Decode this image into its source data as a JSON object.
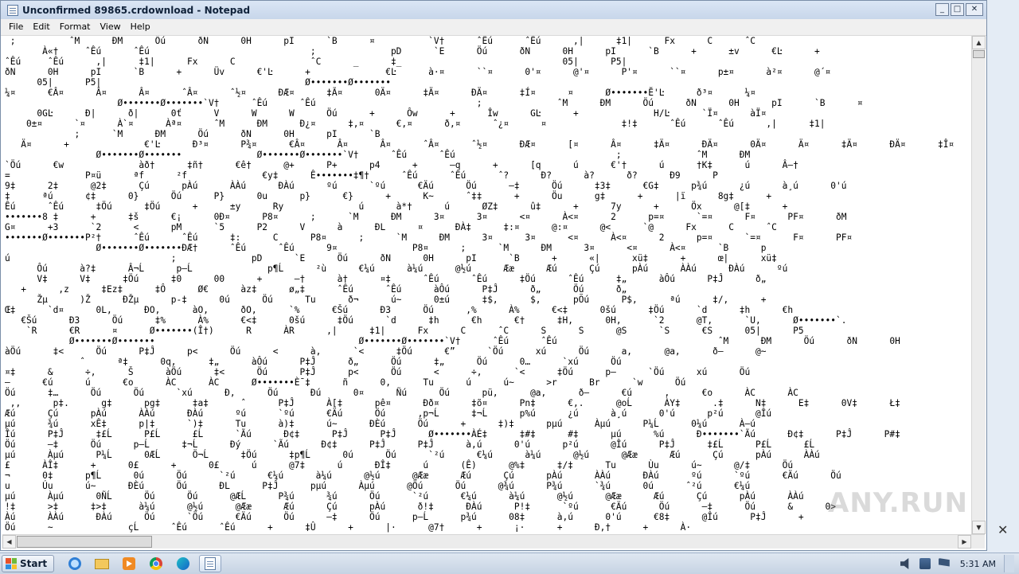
{
  "window": {
    "title": "Unconfirmed 89865.crdownload - Notepad",
    "buttons": {
      "minimize": "_",
      "maximize": "□",
      "close": "✕"
    }
  },
  "menu": [
    "File",
    "Edit",
    "Format",
    "View",
    "Help"
  ],
  "editor": {
    "lines": [
      " ;          ˆM      ÐM      Ôú      ðN      0H      pI      `B      ¤          `V†      ˆÊú      ˆÊú      ,|      ‡1|      Fx      C      ˆC",
      "       À«†     ˆÊú      ˆÊú                              ;              pD      `E      Öú      ðN      0H      pI      `B      +      ±v      €Ŀ      +",
      "ˆÊú     ˆÊú      ,|      ‡1|      Fx      C              ˆC      _      ‡_                              05|      P5|",
      "ðN      0H      pI      `B      +      Üv      €'Ŀ      +              €Ŀ      à·¤      ``¤      0'¤      @'¤      P'¤      ``¤      p±¤      à²¤      @´¤",
      "      05|      P5|                                      Ø•••••••Ø•••••••",
      "¼¤      €Â¤      Â¤      Â¤      ˆÂ¤      ˆ½¤      ÐÆ¤      ‡Ã¤      0Ä¤      ‡Ä¤      ÐÄ¤      ‡Í¤      ¤      Ø•••••••Ĕ'Ŀ      ð³¤      ¼¤",
      "                     Ø•••••••Ø•••••••`V†      ˆÊú      ˆÊú                              ;              ˆM      ÐM      Öú      ðN      0H      pI      `B      ¤",
      "      0GĿ      Ð|      ð|      0ť      V      W      W      Öú      +      Ôw      +      Îw      GĿ      +              H/Ŀ      `Ï¤      àÏ¤",
      "    0±¤      `¤      À`¤      Àª¤      ˆM      ÐM      Ð¿¤      ‡,¤      €,¤      ð,¤      ˆ¿¤      ¤              ‡!‡      ˆÊú      ˆÊú      ,|      ‡1|",
      "             ;      `M      ÐM      Öú      ðN      0H      pI      `B",
      "   Ä¤      +              €'Ŀ      Ð³¤      P¾¤      €Â¤      Â¤      Â¤      ˆÂ¤      ˆ½¤      ÐÆ¤      [¤      Â¤      ‡Ä¤      ÐÄ¤      0Ä¤      Ä¤      ‡Ä¤      ÐÄ¤      ‡Î¤",
      "                 Ø•••••••Ø•••••••              Ø•••••••Ø•••••••`V†      ˆÊú      ˆÊú                              ;              ˆM      ÐM",
      "`Öú      €w              àð†      ‡ñ†      €ê†      @+      P+      p4      +      –q      +      [q      ú      €'†      ú      †K‡      ú      Â–†",
      "=              P¤ü      ªf      ²f              €y‡      Ê•••••••‡¶†      ˆÊú      ˆÊú      ˆ?      Ð?      à?      ð?      Ð9      P",
      "9‡      2‡      @2‡      Çú      pÀú      ÀÀú      ÐÀú      ºú      `ºú      €Äú      Öú      –‡      Öú      ‡3‡      €G‡      p¾ú      ¿ú      à¸ú      0'ú",
      "‡      ªú      ¢‡      0}      Öú      P}      0u      p}      €}      +      K~      ˆ‡‡      +      Öu      g‡      +      |ï      8g‡      +",
      "Êú      ˆÊú      ‡Öú      ‡Öú      +      ±y      Ry              ú      à*†      ú      ØZ‡      û‡      +      7y      +      Öx      @[‡      +",
      "•••••••8 ‡      +      ‡š      €¡      0Ð¤      P8¤      ;      `M      ÐM      3¤      3¤      <¤      À<¤      2      p=¤      `=¤      F¤      PF¤      ðM",
      "G¤      +3      `2      <      pM      `5      P2      V      à      ÐL      ¤      ÐÀ‡      ‡:¤      @:¤      @<      `@      Fx      C      ˆC",
      "•••••••Ø•••••••P²†      ˆÊú      ˆÊú      ‡:      C      P8¤      ;      `M      ÐM      3¤      3¤      <¤      À<¤      2      p=¤      `=¤      F¤      PF¤",
      "                 Ø•••••••Ø•••••••ÐÆ†      ˆÊú      ˆÊú      9¤              P8¤      ;      `M      ÐM      3¤      <¤      À<¤      `B      p",
      "ú                              ;              pD      `E      Öú      ðN      0H      pI      `B      +      «|      xü‡      +      œ|      xü‡",
      "      Ôú      à?‡      Â¬Ĺ      p–Ĺ              p¶Ĺ      ²ù      €¼ú      à¼ú      @½ú      Ææ      Æú      Çú      pÀú      ÀÀú      ÐÀú      ºú",
      "      V‡      V‡      ‡Öú      ‡0      00      +      –†      à†      ¤‡      ˆÊú      ˆÊú      ‡Öú      ˆÊú      ‡„      àÔú      P‡Ĵ      ð„",
      "   +      ,z      ‡Ez‡      ‡Ô      Ø€      àz‡      ø„‡      ˆÊú      ˆÊú      àÔú      P‡Ĵ      ð„      Öú      ð„",
      "      Žµ      )Ž      ÐŽµ      p-‡      0ú      Öú      Tu      ð¬      ú~      0±ú      ‡$,      $,      pÕú      P$,      ªú      ‡/,      +",
      "Œ‡      `d¤      0L,      ÐO,      àO,      ðO,      `%      €Šú      Ð3      Öú      ,%      À%      €<‡      0šú      ‡Öú      `d      ‡h      €h",
      "   €Šú      Ð3      Öú      ‡%      À%      €<‡      0šú      ‡Öú      `d      ‡h      €h      €†      ‡H,      0H,      `2      @T,      `U,      Ø•••••••`.",
      "    `R      €R      ¤      Ø•••••••(Î†)      R      ÀR      ,|      ‡1|      Fx      C      ˆC      S      S      @S      `S      €S      05|      P5",
      "            Ø•••••••Ø•••••••                                      Ø•••••••Ø•••••••`V†      ˆÊú      ˆÊú                              ˆM      ÐM      Öú      ðN      0H",
      "àÖú      ‡<      Öú      P‡Ĵ      p<      Öú      <      à,      `<      ‡Öú      €”      `Öú      xú      Öú      a,      @a,      ð–      @~",
      "              ˆ      ª‡      0q,      ‡„      àÔú      P‡Ĵ      ð„      Öú      ‡„      Öú      0…      `xú      Öú",
      "¤‡      &      ÷,      Š      àÖú      ‡<      Öú      P‡Ĵ      p<      Öú      <      ÷,      `<      ‡Öú      p–      `Öú      xú      Öú",
      "—      €ú      ú      €o      ÀC      ÀC      Ø•••••••È¯‡      ñ      0,      Tu      ú      ú~      >r      Br      `w      Öú",
      "Öú      ‡…      Öú      Öú      `xú      Ð,      Öú      Ðú      0¤      Ñú      Öú      pü,      @a,      ð–      €ú      ,      €o      ÀC      ÀC",
      " ,,      p‡.      g‡      pg‡      ‡a‡      ˆ      P‡Ĵ      À[‡      pê¤      Ðð¤      ‡õ¤      Pn‡      €,.      @oĹ      ÀY‡      .‡      N‡      E‡      0V‡      Ł‡",
      "Æú      Çú      pÀú      ÀÀú      ÐÀú      ºú      `ºú      €Äú      Öú      ,p¬Ĺ      ‡¬Ĺ      p%ú      ¿ú      à¸ú      0'ú      p²ú      @Îú",
      "µú      ¾ú      xÊ‡      p|‡      `)‡      Tu      à)‡      ú~      ÐÈú      Öú      +      ‡)‡      pµú      Àµú      P¼Ĺ      0¼ú      À–ú",
      "Îú      P‡Ĵ      ‡£Ĺ      P£Ĺ      £Ĺ      `Ãú      Ð¢‡      P‡Ĵ      P‡Ĵ      Ø•••••••ÀÉ‡      ‡#‡      #‡      µú      %ú      Ð•••••••`Ãú      Ð¢‡      P‡Ĵ      P#‡",
      "Öú      –‡      Öú      p–Ĺ      ‡¬Ĺ      Ðý      `Ãú      Ð¢‡      P‡Ĵ      P‡Ĵ      à,ú      0'ú      p²ú      @Îú      P‡Ĵ      ‡£Ĺ      P£Ĺ      £Ĺ",
      "µú      Àµú      P¼Ĺ      0ÆĹ      Ö¬Ĺ      ‡Öú      ‡p¶Ĺ      0ú      Öú      `²ú      €¼ú      à¼ú      @½ú      @Ææ      Æú      Çú      pÀú      ÀÀú",
      "£      ÀÎ‡      +      0£      +      0£      ú      @7‡      ú      ÐÎ‡      ú      (Ê)      @%‡      ‡/‡      Tu      Ùu      ú~      @/‡      Öú",
      "¬      0‡      p¶Ĺ      0ú      Öú      `²ú      €¼ú      à¼ú      @½ú      @Ææ      Æú      Çú      pÀú      ÀÀú      ÐÀú      ºú      `ºú      €Äú      Öú",
      "u      Úu      ú~      ÐÈú      Öú      ÐL      P‡Ĵ      pµú      Àµú      @Öú      Öú      @¾ú      P¾ú      `¾ú      0ú      ˆ²ú      €¼ú",
      "µú      Àµú      0ÑĹ      Öú      Öú      @ÆĹ      P¾ú      ¾ú      Öú      `²ú      €¼ú      à¼ú      @½ú      @Ææ      Æú      Çú      pÀú      ÀÀú",
      "!‡      >‡      ‡>‡      à¼ú      @½ú      @Ææ      Æú      Çú      pÀú      ð!‡      ÐÀú      P!‡      `ºú      €Äú      Öú      –‡      Öú      &      0>",
      "Àú      ÀÀú      ÐÀú      Öú      `Öú      €Äú      Öú      –‡      Öú      p–Ĺ      p¾ú      08‡      à,ú      0'ú      €8‡      @Îú      P‡Ĵ      +",
      "Öú      ~              çĹ      ˆÊú      ˆÊú      +      ‡Û      +      |·      @7†      +      ¡·      +      Ð,†      +      À·"
    ]
  },
  "watermark": "ANY.RUN",
  "taskbar": {
    "start_label": "Start",
    "apps": [
      "internet-explorer-icon",
      "explorer-folder-icon",
      "media-player-icon",
      "chrome-icon",
      "edge-icon",
      "notepad-icon"
    ],
    "clock": "5:31 AM"
  }
}
